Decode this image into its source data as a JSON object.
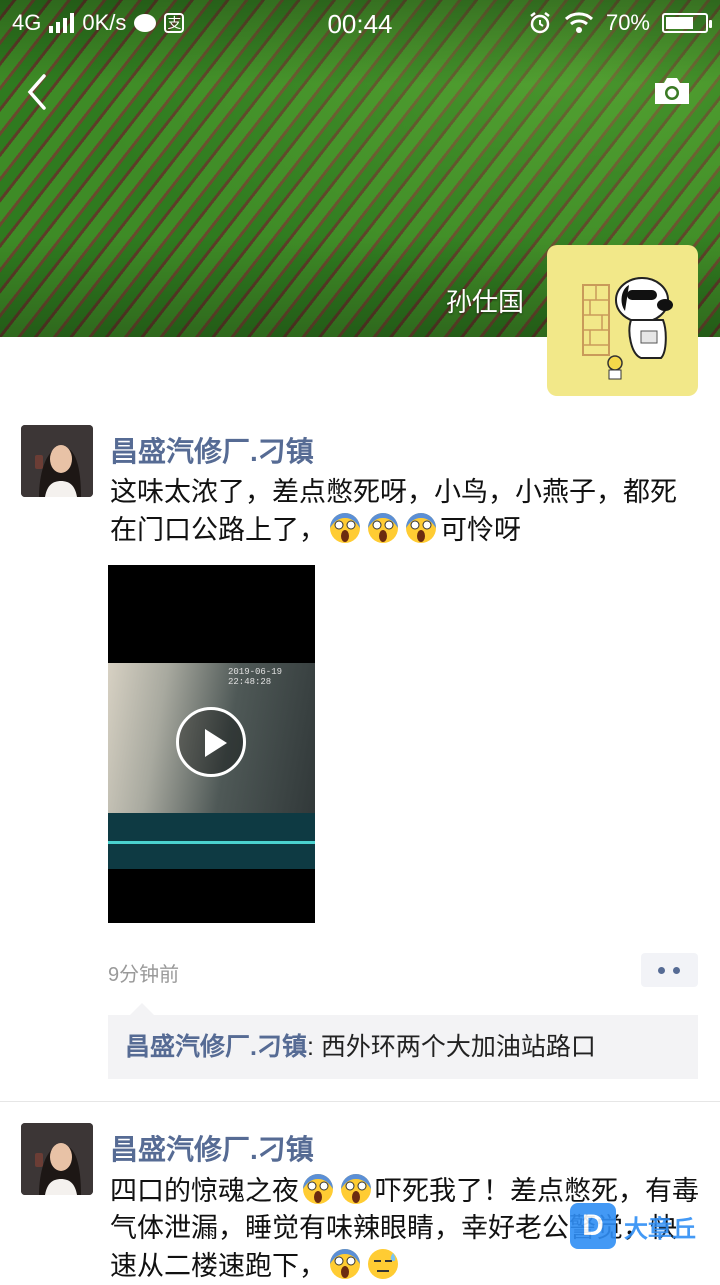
{
  "status_bar": {
    "network": "4G",
    "speed": "0K/s",
    "time": "00:44",
    "battery": "70%",
    "battery_level": 0.7
  },
  "header": {
    "username": "孙仕国"
  },
  "posts": [
    {
      "author": "昌盛汽修厂.刁镇",
      "text_part1": "这味太浓了，差点憋死呀，小鸟，小燕子，都死在门口公路上了，",
      "text_part2": "可怜呀",
      "emojis": [
        "scream-emoji",
        "scream-emoji",
        "scream-emoji"
      ],
      "video_timestamp": "2019-06-19 22:48:28",
      "time_ago": "9分钟前",
      "comments": [
        {
          "author": "昌盛汽修厂.刁镇",
          "separator": ": ",
          "text": "西外环两个大加油站路口"
        }
      ]
    },
    {
      "author": "昌盛汽修厂.刁镇",
      "text_part1": "四口的惊魂之夜",
      "text_part2": "吓死我了！差点憋死，有毒气体泄漏，睡觉有味辣眼睛，幸好老公警觉，快速从二楼速跑下，",
      "emojis": [
        "scream-emoji",
        "scream-emoji",
        "scream-emoji",
        "sweat-emoji"
      ]
    }
  ],
  "watermark": {
    "logo": "D",
    "text": "大章丘"
  },
  "colors": {
    "name_blue": "#566b94",
    "avatar_yellow": "#f2e889"
  }
}
